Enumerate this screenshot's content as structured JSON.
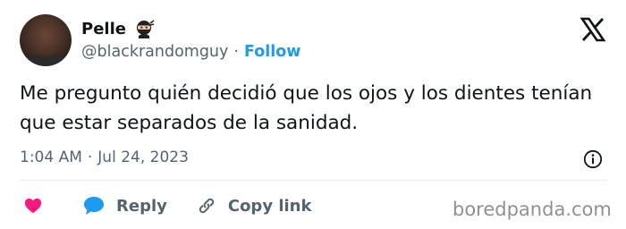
{
  "tweet": {
    "author_name": "Pelle",
    "handle": "@blackrandomguy",
    "separator": "·",
    "follow_label": "Follow",
    "text": "Me pregunto quién decidió que los ojos y los dientes tenían que estar separados de la sanidad.",
    "time": "1:04 AM",
    "date": "Jul 24, 2023"
  },
  "actions": {
    "reply_label": "Reply",
    "copy_link_label": "Copy link"
  },
  "colors": {
    "accent": "#1d9bf0",
    "heart": "#f91880",
    "text": "#0f1419",
    "secondary": "#536471"
  },
  "icons": {
    "badge": "ninja-emoji-icon",
    "logo": "x-logo-icon",
    "info": "info-icon",
    "like": "heart-icon",
    "reply": "speech-bubble-icon",
    "copy": "link-icon"
  },
  "watermark": "boredpanda.com"
}
